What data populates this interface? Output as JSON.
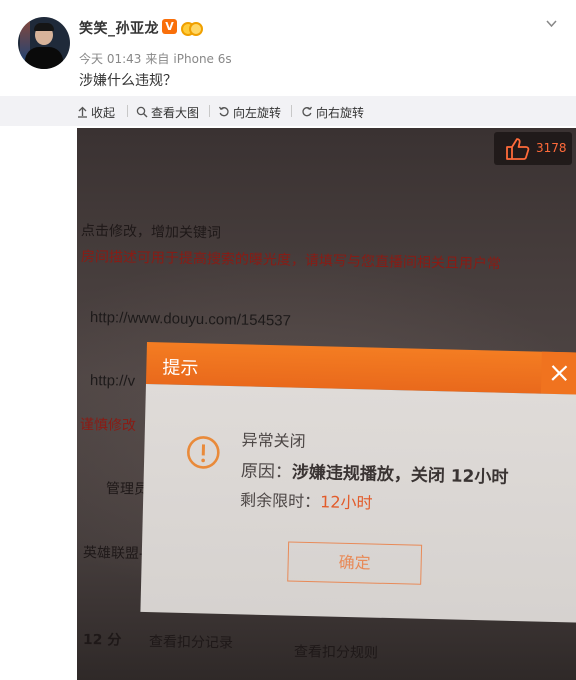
{
  "post": {
    "username": "笑笑_孙亚龙",
    "verify_badge": "V",
    "time": "今天 01:43",
    "source_prefix": "来自",
    "source_device": "iPhone 6s",
    "text": "涉嫌什么违规？",
    "icons": {
      "avatar": "avatar-portrait",
      "verify": "verified-v-badge",
      "vip": "vip-coin-icon",
      "menu": "chevron-down-icon"
    }
  },
  "toolbar": {
    "collapse": "收起",
    "view_large": "查看大图",
    "rotate_left": "向左旋转",
    "rotate_right": "向右旋转"
  },
  "like": {
    "count": "3178",
    "icon": "thumbs-up-icon"
  },
  "photo": {
    "background_lines": [
      {
        "text": "点击修改，增加关键词",
        "color": "dark"
      },
      {
        "text": "房间描述可用于提高搜索的曝光度，请填写与您直播间相关且用户常",
        "color": "red"
      },
      {
        "text": "http://www.douyu.com/154537",
        "color": "link"
      },
      {
        "text": "http://v",
        "color": "link"
      },
      {
        "text": "谨慎修改",
        "color": "red"
      },
      {
        "text": "管理员",
        "color": "dark"
      },
      {
        "text": "英雄联盟-",
        "color": "dark"
      },
      {
        "text": "12 分",
        "color": "dark"
      },
      {
        "text": "查看扣分记录",
        "color": "dark"
      },
      {
        "text": "查看扣分规则",
        "color": "dark"
      }
    ],
    "dialog": {
      "title": "提示",
      "close_icon": "close-icon",
      "warning_icon": "warning-circle-icon",
      "status": "异常关闭",
      "reason_label": "原因：",
      "reason_text": "涉嫌违规播放，关闭 12小时",
      "remaining_label": "剩余限时：",
      "remaining_value": "12小时",
      "confirm": "确定"
    }
  },
  "colors": {
    "accent": "#f47d22",
    "verify": "#f96f0a",
    "remaining": "#e25b2a",
    "like_count": "#ff6a3a"
  }
}
